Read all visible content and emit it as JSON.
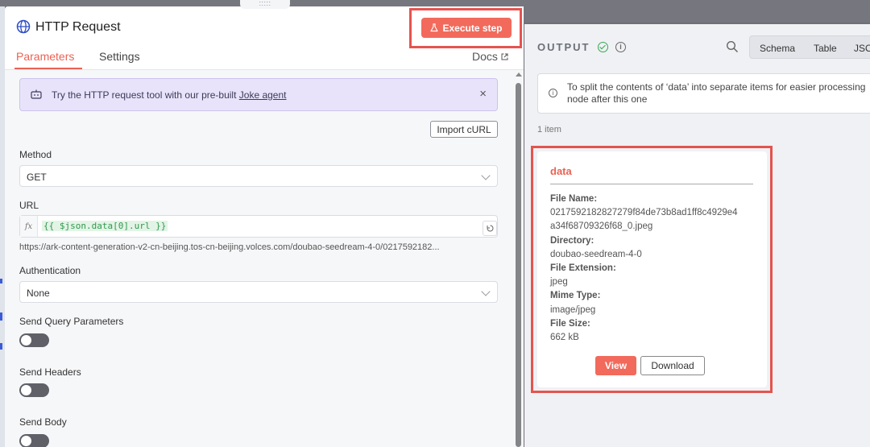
{
  "drag_handle": ":::::",
  "node": {
    "title": "HTTP Request",
    "execute_label": "Execute step",
    "tabs": [
      {
        "label": "Parameters",
        "active": true
      },
      {
        "label": "Settings",
        "active": false
      }
    ],
    "docs_label": "Docs"
  },
  "callout": {
    "text": "Try the HTTP request tool with our pre-built",
    "link": "Joke agent",
    "close": "×"
  },
  "import_curl_label": "Import cURL",
  "method": {
    "label": "Method",
    "value": "GET"
  },
  "url": {
    "label": "URL",
    "fx": "fx",
    "expression": "{{ $json.data[0].url }}",
    "resolved": "https://ark-content-generation-v2-cn-beijing.tos-cn-beijing.volces.com/doubao-seedream-4-0/0217592182..."
  },
  "authentication": {
    "label": "Authentication",
    "value": "None"
  },
  "send_query": {
    "label": "Send Query Parameters",
    "enabled": false
  },
  "send_headers": {
    "label": "Send Headers",
    "enabled": false
  },
  "send_body": {
    "label": "Send Body",
    "enabled": false
  },
  "output": {
    "title": "OUTPUT",
    "views": [
      "Schema",
      "Table",
      "JSO"
    ],
    "banner_line1": "To split the contents of ‘data’ into separate items for easier processing",
    "banner_line2": "node after this one",
    "item_count": "1 item",
    "card": {
      "title": "data",
      "file_name_label": "File Name:",
      "file_name_line1": "0217592182827279f84de73b8ad1ff8c4929e4",
      "file_name_line2": "a34f68709326f68_0.jpeg",
      "directory_label": "Directory:",
      "directory": "doubao-seedream-4-0",
      "extension_label": "File Extension:",
      "extension": "jpeg",
      "mime_label": "Mime Type:",
      "mime": "image/jpeg",
      "size_label": "File Size:",
      "size": "662 kB",
      "view_label": "View",
      "download_label": "Download"
    }
  },
  "colors": {
    "accent": "#ea6254",
    "execute_bg": "#f26a5b",
    "highlight": "#e4544f",
    "success": "#35a853",
    "callout_bg": "#e8e3fa"
  },
  "icons": [
    "globe-icon",
    "flask-icon",
    "external-link-icon",
    "chat-icon",
    "close-icon",
    "chevron-down-icon",
    "fx-icon",
    "expand-icon",
    "check-circle-icon",
    "info-icon",
    "search-icon"
  ]
}
